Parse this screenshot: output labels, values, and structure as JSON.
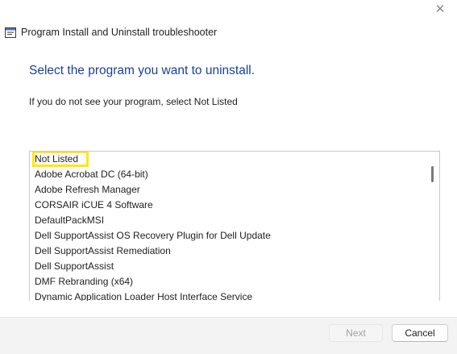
{
  "window": {
    "title": "Program Install and Uninstall troubleshooter",
    "close_glyph": "✕"
  },
  "content": {
    "heading": "Select the program you want to uninstall.",
    "subtext": "If you do not see your program, select Not Listed"
  },
  "program_list": {
    "items": [
      {
        "label": "Not Listed",
        "selected": true
      },
      {
        "label": "Adobe Acrobat DC (64-bit)"
      },
      {
        "label": "Adobe Refresh Manager"
      },
      {
        "label": "CORSAIR iCUE 4 Software"
      },
      {
        "label": "DefaultPackMSI"
      },
      {
        "label": "Dell SupportAssist OS Recovery Plugin for Dell Update"
      },
      {
        "label": "Dell SupportAssist Remediation"
      },
      {
        "label": "Dell SupportAssist"
      },
      {
        "label": "DMF Rebranding (x64)"
      },
      {
        "label": "Dynamic Application Loader Host Interface Service"
      }
    ]
  },
  "footer": {
    "next_label": "Next",
    "cancel_label": "Cancel"
  },
  "colors": {
    "heading": "#1a3f9c",
    "selection_highlight": "#ffe800"
  },
  "icons": {
    "app_icon": "troubleshooter-window-icon",
    "close_icon": "close-icon"
  }
}
